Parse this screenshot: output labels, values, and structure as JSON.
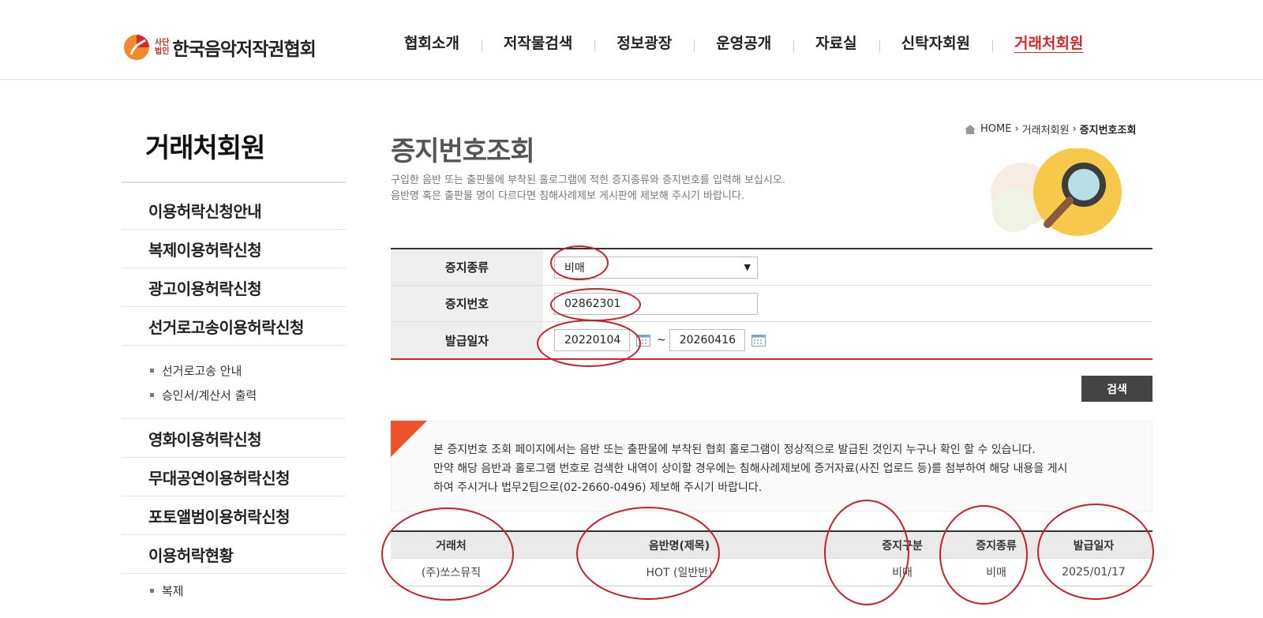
{
  "header": {
    "logo_small": [
      "사단",
      "법인"
    ],
    "logo_text": "한국음악저작권협회",
    "nav": [
      "협회소개",
      "저작물검색",
      "정보광장",
      "운영공개",
      "자료실",
      "신탁자회원",
      "거래처회원"
    ],
    "active_index": 6
  },
  "sidebar": {
    "title": "거래처회원",
    "items": [
      "이용허락신청안내",
      "복제이용허락신청",
      "광고이용허락신청",
      "선거로고송이용허락신청"
    ],
    "sub_items": [
      "선거로고송 안내",
      "승인서/계산서 출력"
    ],
    "items2": [
      "영화이용허락신청",
      "무대공연이용허락신청",
      "포토앨범이용허락신청",
      "이용허락현황"
    ],
    "sub_items2": [
      "복제"
    ]
  },
  "breadcrumb": {
    "home": "HOME",
    "mid": "거래처회원",
    "current": "증지번호조회"
  },
  "page": {
    "title": "증지번호조회",
    "desc_line1": "구입한 음반 또는 출판물에 부착된 홀로그램에 적힌 증지종류와 증지번호를 입력해 보십시오.",
    "desc_line2": "음반명 혹은 출판물 명이 다르다면 침해사례제보 게시판에 제보해 주시기 바랍니다."
  },
  "form": {
    "type_label": "증지종류",
    "type_value": "비매",
    "number_label": "증지번호",
    "number_value": "02862301",
    "date_label": "발급일자",
    "date_from": "20220104",
    "date_sep": "~",
    "date_to": "20260416",
    "search_button": "검색"
  },
  "notice": {
    "line1": "본 증지번호 조회 페이지에서는 음반 또는 출판물에 부착된 협회 홀로그램이 정상적으로 발급된 것인지 누구나 확인 할 수 있습니다.",
    "line2": "만약 해당 음반과 홀로그램 번호로 검색한 내역이 상이할 경우에는 침해사례제보에 증거자료(사진 업로드 등)를 첨부하여 해당 내용을 게시",
    "line3": "하여 주시거나 법무2팀으로(02-2660-0496) 제보해 주시기 바랍니다."
  },
  "result": {
    "headers": [
      "거래처",
      "음반명(제목)",
      "증지구분",
      "증지종류",
      "발급일자"
    ],
    "rows": [
      [
        "(주)쏘스뮤직",
        "HOT (일반반)",
        "비매",
        "비매",
        "2025/01/17"
      ]
    ]
  },
  "colors": {
    "accent": "#d8262a",
    "corner": "#f0522a",
    "annotation": "#c8202a"
  }
}
